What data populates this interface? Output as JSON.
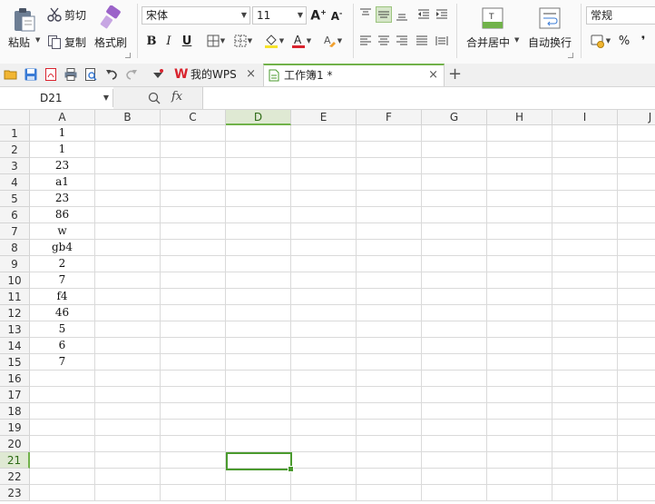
{
  "ribbon": {
    "paste_label": "粘贴",
    "cut_label": "剪切",
    "copy_label": "复制",
    "format_painter_label": "格式刷",
    "font_name": "宋体",
    "font_size": "11",
    "merge_center_label": "合并居中",
    "wrap_text_label": "自动换行",
    "number_format": "常规",
    "percent_label": "%",
    "comma_label": "❜"
  },
  "tabs": {
    "wps_label": "我的WPS",
    "workbook_label": "工作簿1 *",
    "add_label": "+"
  },
  "formula_bar": {
    "name_box": "D21",
    "fx_label": "fx",
    "formula": ""
  },
  "sheet": {
    "columns": [
      "A",
      "B",
      "C",
      "D",
      "E",
      "F",
      "G",
      "H",
      "I",
      "J"
    ],
    "selected_column": "D",
    "selected_row": 21,
    "rows": [
      {
        "num": "1",
        "a": "1"
      },
      {
        "num": "2",
        "a": "1"
      },
      {
        "num": "3",
        "a": "23"
      },
      {
        "num": "4",
        "a": "a1"
      },
      {
        "num": "5",
        "a": "23"
      },
      {
        "num": "6",
        "a": "86"
      },
      {
        "num": "7",
        "a": "w"
      },
      {
        "num": "8",
        "a": "gb4"
      },
      {
        "num": "9",
        "a": "2"
      },
      {
        "num": "10",
        "a": "7"
      },
      {
        "num": "11",
        "a": "f4"
      },
      {
        "num": "12",
        "a": "46"
      },
      {
        "num": "13",
        "a": "5"
      },
      {
        "num": "14",
        "a": "6"
      },
      {
        "num": "15",
        "a": "7"
      },
      {
        "num": "16",
        "a": ""
      },
      {
        "num": "17",
        "a": ""
      },
      {
        "num": "18",
        "a": ""
      },
      {
        "num": "19",
        "a": ""
      },
      {
        "num": "20",
        "a": ""
      },
      {
        "num": "21",
        "a": ""
      },
      {
        "num": "22",
        "a": ""
      },
      {
        "num": "23",
        "a": ""
      }
    ]
  },
  "colors": {
    "accent_green": "#71b24a",
    "selection_border": "#4a9a2e",
    "wps_red": "#d9232e"
  }
}
